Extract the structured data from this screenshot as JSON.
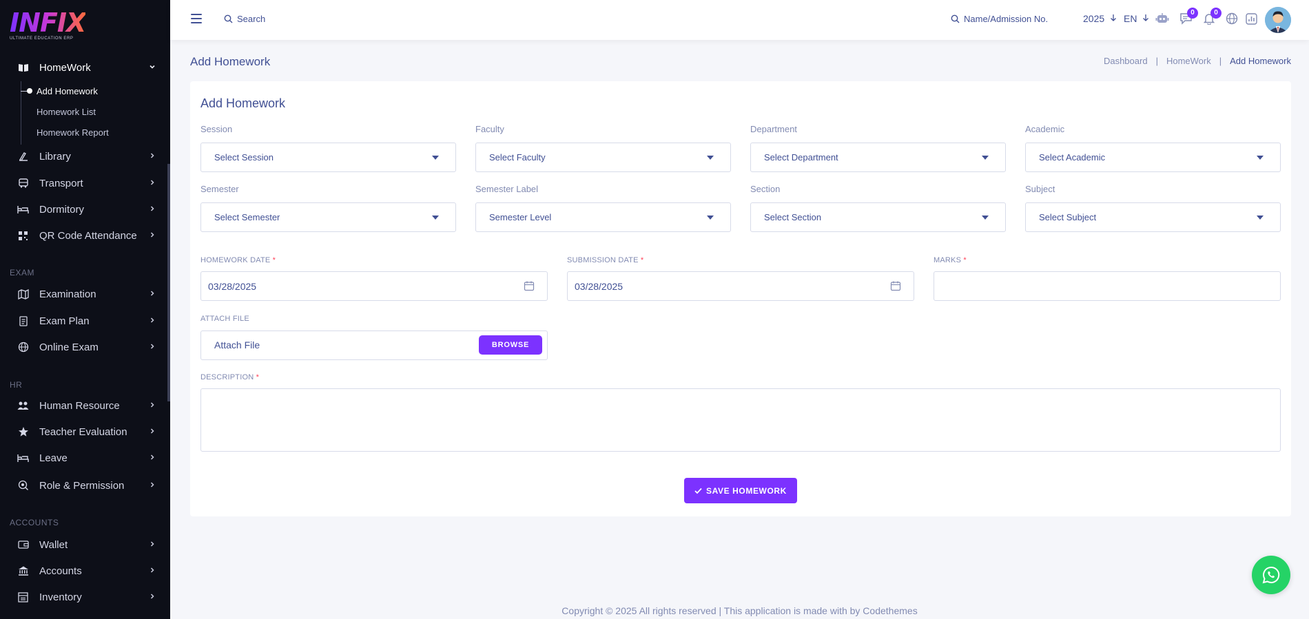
{
  "brand": {
    "logo_text": "INFIX",
    "tagline": "ULTIMATE EDUCATION ERP",
    "accent": "#7c32ff"
  },
  "sidebar": {
    "homework": {
      "label": "HomeWork",
      "subitems": [
        "Add Homework",
        "Homework List",
        "Homework Report"
      ]
    },
    "items_top": [
      {
        "label": "Library",
        "icon": "library-icon"
      },
      {
        "label": "Transport",
        "icon": "bus-icon"
      },
      {
        "label": "Dormitory",
        "icon": "bed-icon"
      },
      {
        "label": "QR Code Attendance",
        "icon": "qr-icon"
      }
    ],
    "exam_heading": "EXAM",
    "exam_items": [
      {
        "label": "Examination",
        "icon": "map-icon"
      },
      {
        "label": "Exam Plan",
        "icon": "clipboard-icon"
      },
      {
        "label": "Online Exam",
        "icon": "globe-icon"
      }
    ],
    "hr_heading": "HR",
    "hr_items": [
      {
        "label": "Human Resource",
        "icon": "users-icon"
      },
      {
        "label": "Teacher Evaluation",
        "icon": "star-icon"
      },
      {
        "label": "Leave",
        "icon": "bed-icon"
      },
      {
        "label": "Role & Permission",
        "icon": "key-icon"
      }
    ],
    "accounts_heading": "ACCOUNTS",
    "accounts_items": [
      {
        "label": "Wallet",
        "icon": "wallet-icon"
      },
      {
        "label": "Accounts",
        "icon": "bank-icon"
      },
      {
        "label": "Inventory",
        "icon": "inventory-icon"
      }
    ]
  },
  "topbar": {
    "search_label": "Search",
    "student_search_label": "Name/Admission No.",
    "year": "2025",
    "language": "EN",
    "messages_count": "0",
    "notifications_count": "0"
  },
  "page": {
    "title": "Add Homework",
    "breadcrumb": [
      "Dashboard",
      "HomeWork",
      "Add Homework"
    ]
  },
  "form": {
    "title": "Add Homework",
    "selects": [
      {
        "label": "Session",
        "placeholder": "Select Session"
      },
      {
        "label": "Faculty",
        "placeholder": "Select Faculty"
      },
      {
        "label": "Department",
        "placeholder": "Select Department"
      },
      {
        "label": "Academic",
        "placeholder": "Select Academic"
      },
      {
        "label": "Semester",
        "placeholder": "Select Semester"
      },
      {
        "label": "Semester Label",
        "placeholder": "Semester Level"
      },
      {
        "label": "Section",
        "placeholder": "Select Section"
      },
      {
        "label": "Subject",
        "placeholder": "Select Subject"
      }
    ],
    "homework_date_label": "HOMEWORK DATE",
    "homework_date_value": "03/28/2025",
    "submission_date_label": "SUBMISSION DATE",
    "submission_date_value": "03/28/2025",
    "marks_label": "MARKS",
    "marks_value": "",
    "attach_label": "ATTACH FILE",
    "attach_placeholder": "Attach File",
    "browse_label": "BROWSE",
    "description_label": "DESCRIPTION",
    "description_value": "",
    "required_mark": "*",
    "save_label": "SAVE HOMEWORK"
  },
  "footer": {
    "text": "Copyright © 2025 All rights reserved | This application is made with by Codethemes"
  }
}
